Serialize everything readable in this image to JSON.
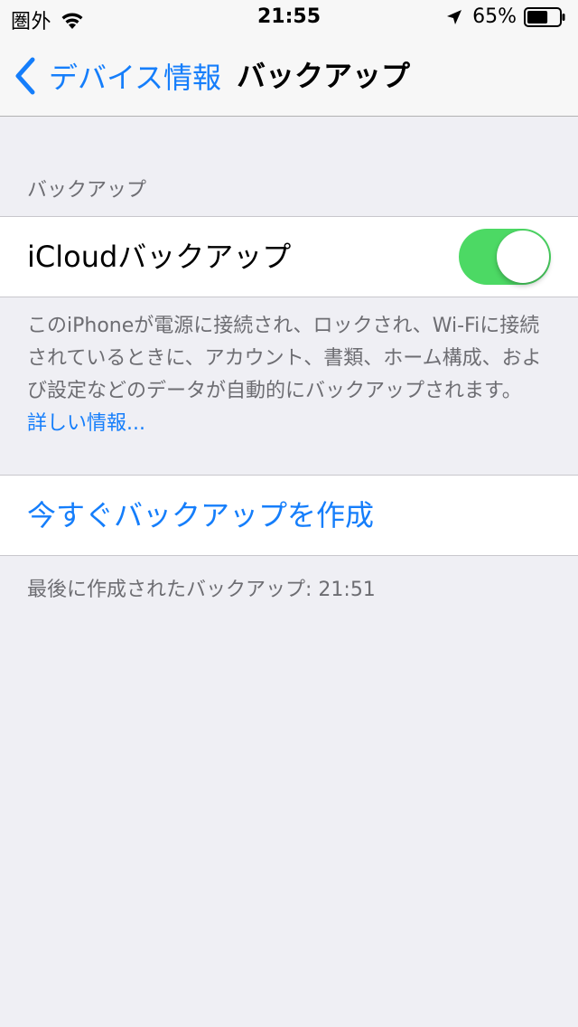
{
  "status_bar": {
    "carrier": "圏外",
    "time": "21:55",
    "battery_percent": "65%",
    "battery_level": 0.65,
    "icons": [
      "wifi-icon",
      "location-arrow-icon",
      "battery-icon"
    ]
  },
  "nav": {
    "back_label": "デバイス情報",
    "title": "バックアップ"
  },
  "section": {
    "header": "バックアップ",
    "toggle_label": "iCloudバックアップ",
    "toggle_on": true,
    "footer_text": "このiPhoneが電源に接続され、ロックされ、Wi-Fiに接続されているときに、アカウント、書類、ホーム構成、および設定などのデータが自動的にバックアップされます。",
    "learn_more": "詳しい情報..."
  },
  "action": {
    "backup_now_label": "今すぐバックアップを作成",
    "last_backup_text": "最後に作成されたバックアップ: 21:51"
  },
  "colors": {
    "tint": "#157EFB",
    "toggle_on": "#4CD964",
    "background": "#EFEFF4",
    "secondary_text": "#6D6D72"
  }
}
